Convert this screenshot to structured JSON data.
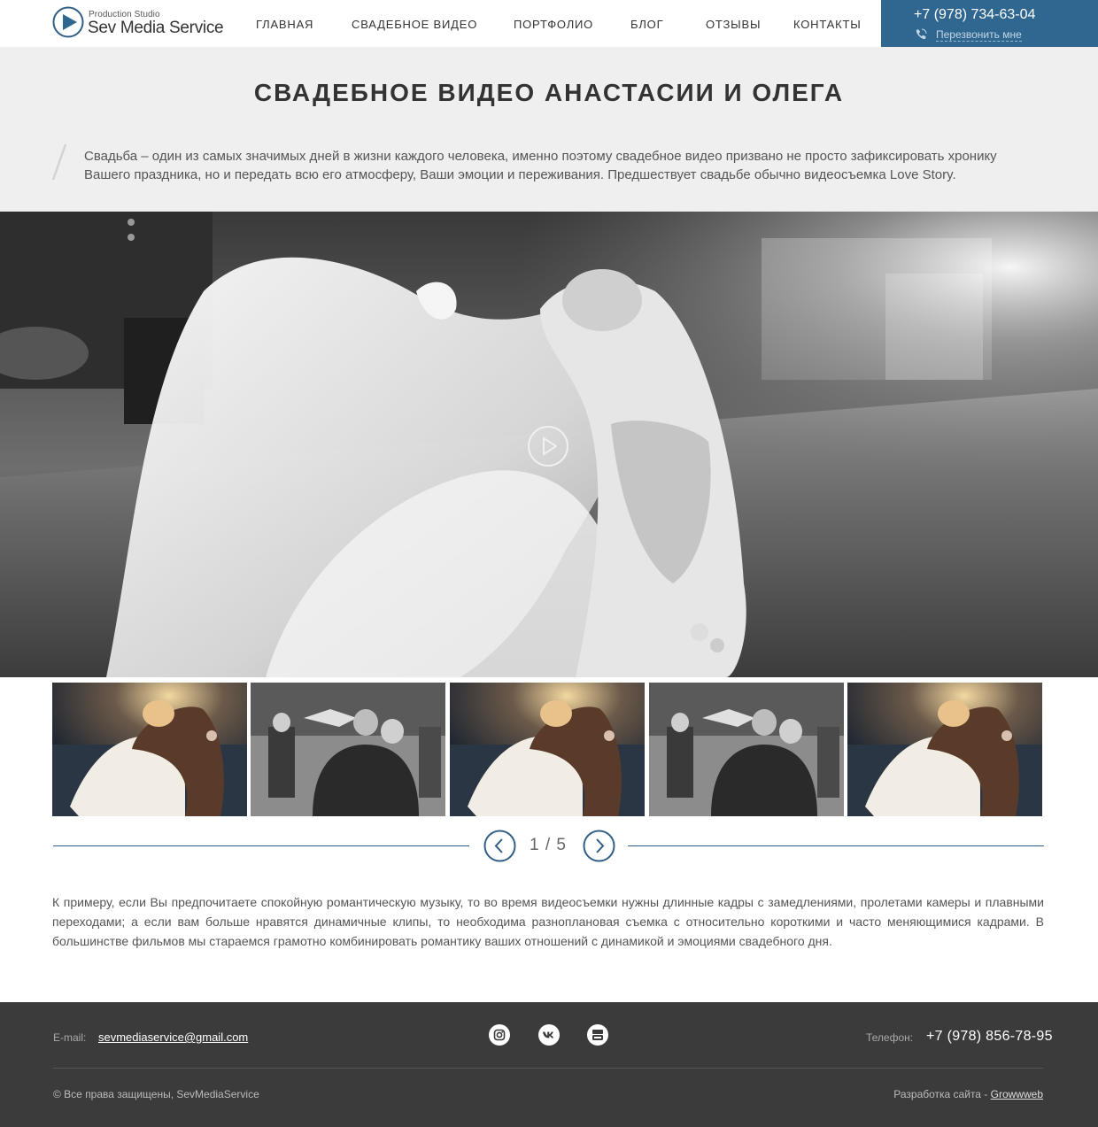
{
  "header": {
    "logo_small": "Production Studio",
    "logo_big": "Sev Media Service",
    "nav": [
      {
        "label": "ГЛАВНАЯ"
      },
      {
        "label": "СВАДЕБНОЕ ВИДЕО"
      },
      {
        "label": "ПОРТФОЛИО"
      },
      {
        "label": "БЛОГ"
      },
      {
        "label": "ОТЗЫВЫ"
      },
      {
        "label": "КОНТАКТЫ"
      }
    ],
    "phone": "+7 (978) 734-63-04",
    "callback": "Перезвонить мне"
  },
  "intro": {
    "title": "СВАДЕБНОЕ ВИДЕО АНАСТАСИИ И ОЛЕГА",
    "text": "Свадьба – один из самых значимых дней в жизни каждого человека, именно поэтому свадебное видео призвано не просто зафиксировать хронику Вашего праздника, но и передать всю его атмосферу, Ваши эмоции и переживания. Предшествует свадьбе обычно видеосъемка Love Story."
  },
  "gallery": {
    "thumbnails": [
      {
        "scene": "bride-and-groom-sunset-icon"
      },
      {
        "scene": "guests-hugging-icon"
      },
      {
        "scene": "bride-and-groom-sunset-icon"
      },
      {
        "scene": "guests-hugging-icon"
      },
      {
        "scene": "bride-and-groom-sunset-icon"
      }
    ],
    "current_page": 1,
    "total_pages": 5,
    "pager_text": "1 / 5"
  },
  "body": {
    "text": "К примеру, если Вы предпочитаете спокойную романтическую музыку, то во время видеосъемки нужны длинные кадры с замедлениями, пролетами камеры и плавными переходами; а если вам больше нравятся динамичные клипы, то необходима разноплановая съемка с относительно короткими и часто меняющимися кадрами. В большинстве фильмов мы стараемся грамотно комбинировать романтику ваших отношений с динамикой и эмоциями свадебного дня."
  },
  "footer": {
    "email_label": "E-mail:",
    "email": "sevmediaservice@gmail.com",
    "social": [
      "instagram-icon",
      "vk-icon",
      "youtube-icon"
    ],
    "phone_label": "Телефон:",
    "phone": "+7 (978) 856-78-95",
    "copyright": "© Все права защищены, SevMediaService",
    "dev_label": "Разработка сайта - ",
    "dev_link": "Growwweb"
  },
  "colors": {
    "accent": "#2f6790",
    "intro_bg": "#efefef",
    "footer_bg": "#3b3b3b"
  }
}
